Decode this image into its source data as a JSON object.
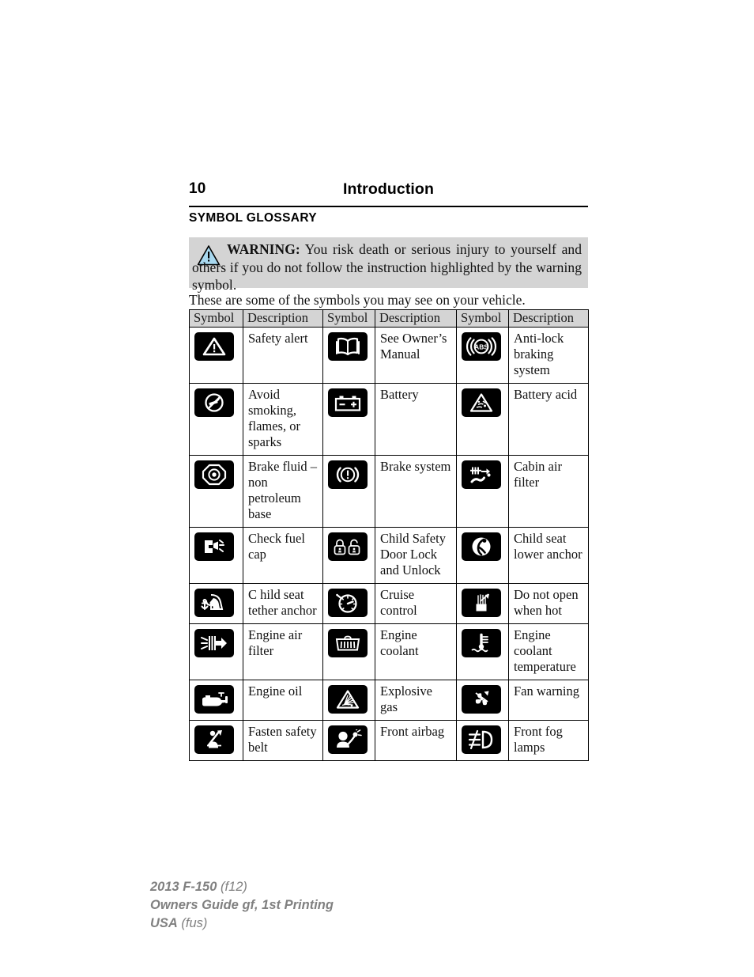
{
  "header": {
    "page_number": "10",
    "title": "Introduction"
  },
  "section": {
    "heading": "SYMBOL GLOSSARY"
  },
  "warning": {
    "icon": "warning-triangle-icon",
    "lead": "WARNING:",
    "body": " You risk death or serious injury to yourself and others if you do not follow the instruction highlighted by the warning symbol."
  },
  "intro": {
    "text": "These are some of the symbols you may see on your vehicle."
  },
  "table": {
    "headers": [
      "Symbol",
      "Description",
      "Symbol",
      "Description",
      "Symbol",
      "Description"
    ],
    "rows": [
      [
        {
          "icon": "safety-alert-icon",
          "label": "Safety alert"
        },
        {
          "icon": "owners-manual-book-icon",
          "label": "See Owner’s Manual"
        },
        {
          "icon": "abs-icon",
          "label": "Anti-lock braking system"
        }
      ],
      [
        {
          "icon": "no-smoking-no-flames-icon",
          "label": "Avoid smoking, flames, or sparks"
        },
        {
          "icon": "battery-icon",
          "label": "Battery"
        },
        {
          "icon": "battery-acid-icon",
          "label": "Battery acid"
        }
      ],
      [
        {
          "icon": "brake-fluid-icon",
          "label": "Brake fluid – non petroleum base"
        },
        {
          "icon": "brake-system-icon",
          "label": "Brake system"
        },
        {
          "icon": "cabin-air-filter-icon",
          "label": "Cabin air filter"
        }
      ],
      [
        {
          "icon": "check-fuel-cap-icon",
          "label": "Check fuel cap"
        },
        {
          "icon": "child-safety-door-lock-icon",
          "label": "Child Safety Door Lock and Unlock"
        },
        {
          "icon": "child-seat-lower-anchor-icon",
          "label": "Child seat lower anchor"
        }
      ],
      [
        {
          "icon": "child-seat-tether-anchor-icon",
          "label": "C hild seat tether anchor"
        },
        {
          "icon": "cruise-control-icon",
          "label": "Cruise control"
        },
        {
          "icon": "do-not-open-when-hot-icon",
          "label": "Do not open when hot"
        }
      ],
      [
        {
          "icon": "engine-air-filter-icon",
          "label": "Engine air filter"
        },
        {
          "icon": "engine-coolant-icon",
          "label": "Engine coolant"
        },
        {
          "icon": "engine-coolant-temperature-icon",
          "label": "Engine coolant temperature"
        }
      ],
      [
        {
          "icon": "engine-oil-icon",
          "label": "Engine oil"
        },
        {
          "icon": "explosive-gas-icon",
          "label": "Explosive gas"
        },
        {
          "icon": "fan-warning-icon",
          "label": "Fan warning"
        }
      ],
      [
        {
          "icon": "fasten-safety-belt-icon",
          "label": "Fasten safety belt"
        },
        {
          "icon": "front-airbag-icon",
          "label": "Front airbag"
        },
        {
          "icon": "front-fog-lamps-icon",
          "label": "Front fog lamps"
        }
      ]
    ]
  },
  "footer": {
    "line1_bold": "2013 F-150",
    "line1_reg": " (f12)",
    "line2": "Owners Guide gf, 1st Printing",
    "line3_bold": "USA",
    "line3_reg": " (fus)"
  },
  "colors": {
    "header_band": "#d4d4d4",
    "icon_bg": "#000000",
    "footer_text": "#808080",
    "warning_triangle_fill": "#a8d8ef"
  }
}
